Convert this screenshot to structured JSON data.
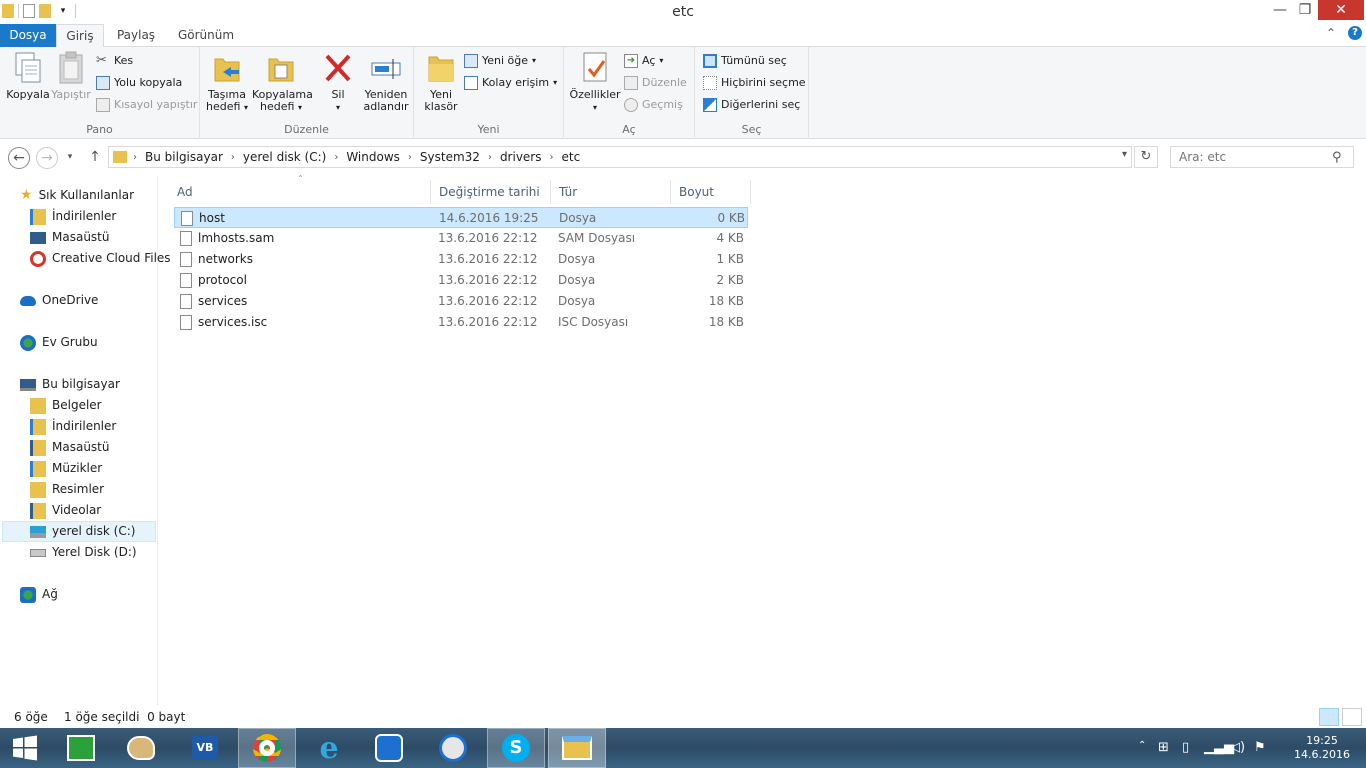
{
  "window": {
    "title": "etc"
  },
  "tabs": {
    "file": "Dosya",
    "home": "Giriş",
    "share": "Paylaş",
    "view": "Görünüm"
  },
  "ribbon": {
    "pano": {
      "label": "Pano",
      "copy": "Kopyala",
      "paste": "Yapıştır",
      "cut": "Kes",
      "copy_path": "Yolu kopyala",
      "paste_shortcut": "Kısayol yapıştır"
    },
    "duzenle": {
      "label": "Düzenle",
      "move_to_1": "Taşıma",
      "move_to_2": "hedefi",
      "copy_to_1": "Kopyalama",
      "copy_to_2": "hedefi",
      "delete": "Sil",
      "rename_1": "Yeniden",
      "rename_2": "adlandır"
    },
    "yeni": {
      "label": "Yeni",
      "new_folder_1": "Yeni",
      "new_folder_2": "klasör",
      "new_item": "Yeni öğe",
      "easy_access": "Kolay erişim"
    },
    "ac": {
      "label": "Aç",
      "properties": "Özellikler",
      "open": "Aç",
      "edit": "Düzenle",
      "history": "Geçmiş"
    },
    "sec": {
      "label": "Seç",
      "select_all": "Tümünü seç",
      "select_none": "Hiçbirini seçme",
      "invert": "Diğerlerini seç"
    }
  },
  "address": {
    "crumbs": [
      "Bu bilgisayar",
      "yerel disk (C:)",
      "Windows",
      "System32",
      "drivers",
      "etc"
    ],
    "search_placeholder": "Ara: etc"
  },
  "navpane": {
    "favorites": "Sık Kullanılanlar",
    "fav_items": [
      "İndirilenler",
      "Masaüstü",
      "Creative Cloud Files"
    ],
    "onedrive": "OneDrive",
    "homegroup": "Ev Grubu",
    "thispc": "Bu bilgisayar",
    "pc_items": [
      "Belgeler",
      "İndirilenler",
      "Masaüstü",
      "Müzikler",
      "Resimler",
      "Videolar",
      "yerel disk (C:)",
      "Yerel Disk (D:)"
    ],
    "network": "Ağ"
  },
  "columns": {
    "name": "Ad",
    "date": "Değiştirme tarihi",
    "type": "Tür",
    "size": "Boyut"
  },
  "files": [
    {
      "name": "host",
      "date": "14.6.2016 19:25",
      "type": "Dosya",
      "size": "0 KB"
    },
    {
      "name": "lmhosts.sam",
      "date": "13.6.2016 22:12",
      "type": "SAM Dosyası",
      "size": "4 KB"
    },
    {
      "name": "networks",
      "date": "13.6.2016 22:12",
      "type": "Dosya",
      "size": "1 KB"
    },
    {
      "name": "protocol",
      "date": "13.6.2016 22:12",
      "type": "Dosya",
      "size": "2 KB"
    },
    {
      "name": "services",
      "date": "13.6.2016 22:12",
      "type": "Dosya",
      "size": "18 KB"
    },
    {
      "name": "services.isc",
      "date": "13.6.2016 22:12",
      "type": "ISC Dosyası",
      "size": "18 KB"
    }
  ],
  "status": {
    "count": "6 öğe",
    "selected": "1 öğe seçildi  0 bayt"
  },
  "taskbar": {
    "time": "19:25",
    "date": "14.6.2016"
  }
}
